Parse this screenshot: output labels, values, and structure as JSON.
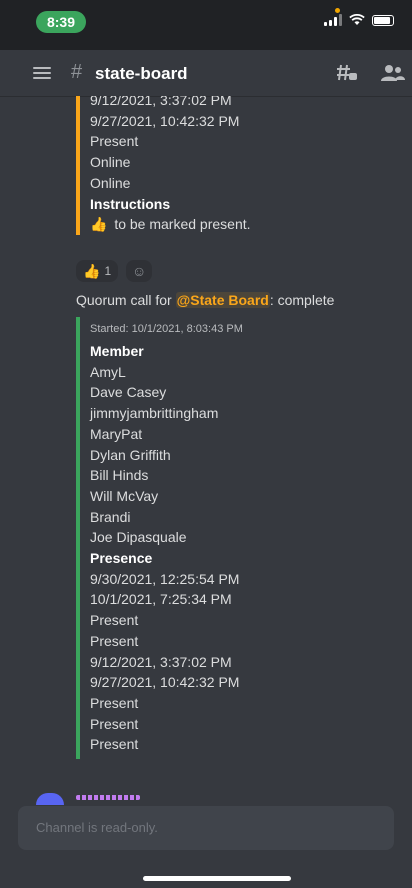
{
  "status": {
    "time": "8:39"
  },
  "header": {
    "hash": "#",
    "channel": "state-board"
  },
  "embed1": {
    "lines": [
      "9/12/2021, 3:37:02 PM",
      "9/27/2021, 10:42:32 PM",
      "Present",
      "Online",
      "Online",
      "Instructions"
    ],
    "instruction_emoji": "👍",
    "instruction_text": "to be marked present."
  },
  "reactions": {
    "thumb_emoji": "👍",
    "thumb_count": "1",
    "add_icon": "☺"
  },
  "quorum": {
    "prefix": "Quorum call for ",
    "mention": "@State Board",
    "suffix": ": complete"
  },
  "embed2": {
    "started": "Started: 10/1/2021, 8:03:43 PM",
    "member_header": "Member",
    "members": [
      "AmyL",
      "Dave Casey",
      "jimmyjambrittingham",
      "MaryPat",
      "Dylan Griffith",
      "Bill Hinds",
      "Will McVay",
      "Brandi",
      "Joe Dipasquale"
    ],
    "presence_header": "Presence",
    "presence": [
      "9/30/2021, 12:25:54 PM",
      "10/1/2021, 7:25:34 PM",
      "Present",
      "Present",
      "9/12/2021, 3:37:02 PM",
      "9/27/2021, 10:42:32 PM",
      "Present",
      "Present",
      "Present"
    ]
  },
  "composer": {
    "placeholder": "Channel is read-only."
  },
  "colors": {
    "embed1_bar": "#faa61a",
    "embed2_bar": "#3ba55d",
    "mention": "#faa61a"
  }
}
